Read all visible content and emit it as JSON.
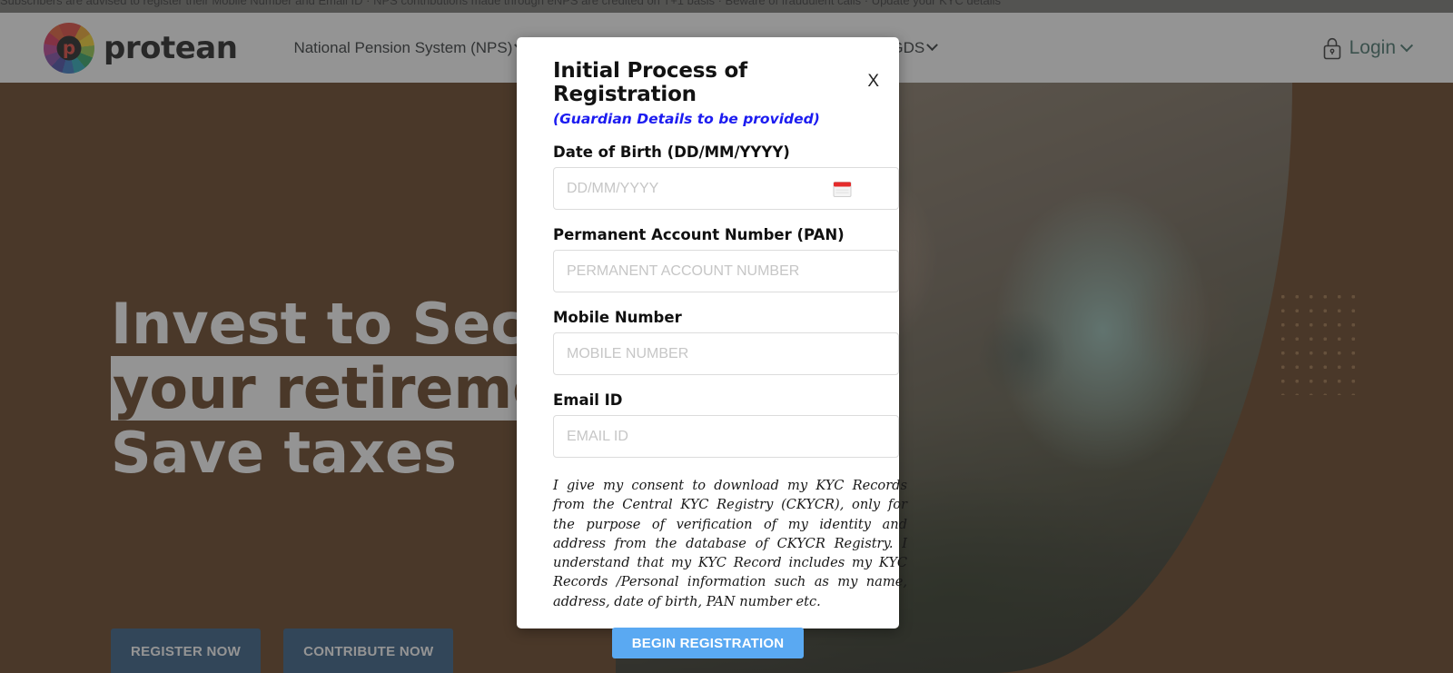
{
  "ticker": {
    "text": "Subscribers are advised to register their Mobile Number and Email ID  ·  NPS contributions made through eNPS are credited on T+1 basis  ·  Beware of fraudulent calls  ·  Update your KYC details"
  },
  "header": {
    "logo_text": "protean",
    "nav": [
      {
        "label": "National Pension System (NPS)",
        "has_caret": true
      },
      {
        "label": "GDS",
        "has_caret": true
      }
    ],
    "login_label": "Login",
    "lock_icon": "lock-icon",
    "caret_icon": "chevron-down-icon"
  },
  "hero": {
    "heading_line_1": "Invest to Secure",
    "heading_line_2": "your retirement",
    "heading_line_3": "Save taxes",
    "buttons": [
      {
        "label": "REGISTER NOW"
      },
      {
        "label": "CONTRIBUTE NOW"
      }
    ],
    "background_color": "#5c3312",
    "button_color": "#27527d"
  },
  "modal": {
    "title": "Initial Process of Registration",
    "subtitle": "(Guardian Details to be provided)",
    "subtitle_color": "#1c1cf0",
    "close_label": "X",
    "fields": [
      {
        "name": "date-of-birth",
        "label": "Date of Birth (DD/MM/YYYY)",
        "placeholder": "DD/MM/YYYY",
        "value": "",
        "icon": "calendar-icon"
      },
      {
        "name": "pan",
        "label": "Permanent Account Number (PAN)",
        "placeholder": "PERMANENT ACCOUNT NUMBER",
        "value": ""
      },
      {
        "name": "mobile-number",
        "label": "Mobile Number",
        "placeholder": "MOBILE NUMBER",
        "value": ""
      },
      {
        "name": "email-id",
        "label": "Email ID",
        "placeholder": "EMAIL ID",
        "value": ""
      }
    ],
    "consent_text": "I give my consent to download my KYC Records from the Central KYC Registry (CKYCR), only for the purpose of verification of my identity and address from the database of CKYCR Registry. I understand that my KYC Record includes my KYC Records /Personal information such as my name, address, date of birth, PAN number etc.",
    "submit_label": "BEGIN REGISTRATION",
    "submit_color": "#5aa9f2"
  }
}
